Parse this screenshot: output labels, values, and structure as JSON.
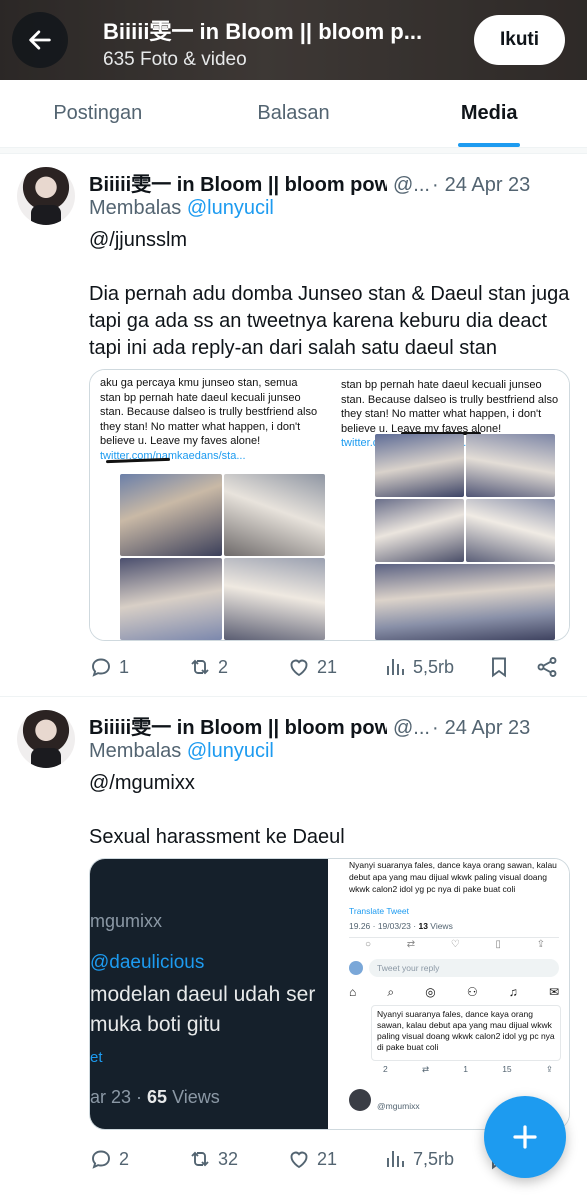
{
  "header": {
    "title": "Biiiii雯一 in Bloom || bloom p...",
    "subtitle": "635 Foto & video",
    "follow_label": "Ikuti"
  },
  "tabs": [
    {
      "label": "Postingan",
      "active": false
    },
    {
      "label": "Balasan",
      "active": false
    },
    {
      "label": "Media",
      "active": true
    }
  ],
  "tweets": [
    {
      "name": "Biiiii雯一 in Bloom || bloom pow",
      "handle": "@...",
      "dot": "·",
      "date": "24 Apr 23",
      "reply_prefix": "Membalas",
      "reply_to": "@lunyucil",
      "text_line1": "@/jjunsslm",
      "text_body": "Dia pernah adu domba Junseo stan & Daeul stan juga tapi ga ada ss an tweetnya karena keburu dia deact tapi ini ada reply-an dari salah satu daeul stan",
      "media_left_text": "aku ga percaya kmu junseo stan, semua stan bp pernah hate daeul kecuali junseo stan. Because dalseo is trully bestfriend also they stan! No matter what happen, i don't believe u. Leave my faves alone!",
      "media_left_link": "twitter.com/namkaedans/sta...",
      "media_right_text": "stan bp pernah hate daeul kecuali junseo stan. Because dalseo is trully bestfriend also they stan! No matter what happen, i don't believe u. Leave my faves alone!",
      "media_right_link": "twitter.com/yujintubbies/s...",
      "replies": "1",
      "retweets": "2",
      "likes": "21",
      "views": "5,5rb"
    },
    {
      "name": "Biiiii雯一 in Bloom || bloom pow",
      "handle": "@...",
      "dot": "·",
      "date": "24 Apr 23",
      "reply_prefix": "Membalas",
      "reply_to": "@lunyucil",
      "text_line1": "@/mgumixx",
      "text_body": "Sexual harassment ke Daeul",
      "media_left_user": "mgumixx",
      "media_left_mention": "@daeulicious",
      "media_left_line1": "modelan daeul udah ser",
      "media_left_line2": "muka boti gitu",
      "media_left_et": "et",
      "media_left_date": "ar 23 · ",
      "media_left_views_num": "65",
      "media_left_views_label": " Views",
      "media_right_text": "Nyanyi suaranya fales, dance kaya orang sawan, kalau debut apa yang mau dijual wkwk paling visual doang wkwk calon2 idol yg pc nya di pake buat coli",
      "media_right_translate": "Translate Tweet",
      "media_right_meta": "19.26 · 19/03/23 · ",
      "media_right_meta_views": "13",
      "media_right_meta_views_label": " Views",
      "media_right_reply_placeholder": "Tweet your reply",
      "media_right_quote": "Nyanyi suaranya fales, dance kaya orang sawan, kalau debut apa yang mau dijual wkwk paling visual doang wkwk calon2 idol yg pc nya di pake buat coli",
      "media_right_small_counts": [
        "2",
        "1",
        "15"
      ],
      "media_right_footer_user": "@mgumixx",
      "replies": "2",
      "retweets": "32",
      "likes": "21",
      "views": "7,5rb"
    }
  ],
  "colors": {
    "accent": "#1d9bf0",
    "text": "#0f1419",
    "muted": "#536471"
  },
  "icons": [
    "back-arrow-icon",
    "reply-icon",
    "retweet-icon",
    "like-icon",
    "views-icon",
    "bookmark-icon",
    "share-icon",
    "compose-plus-icon"
  ]
}
